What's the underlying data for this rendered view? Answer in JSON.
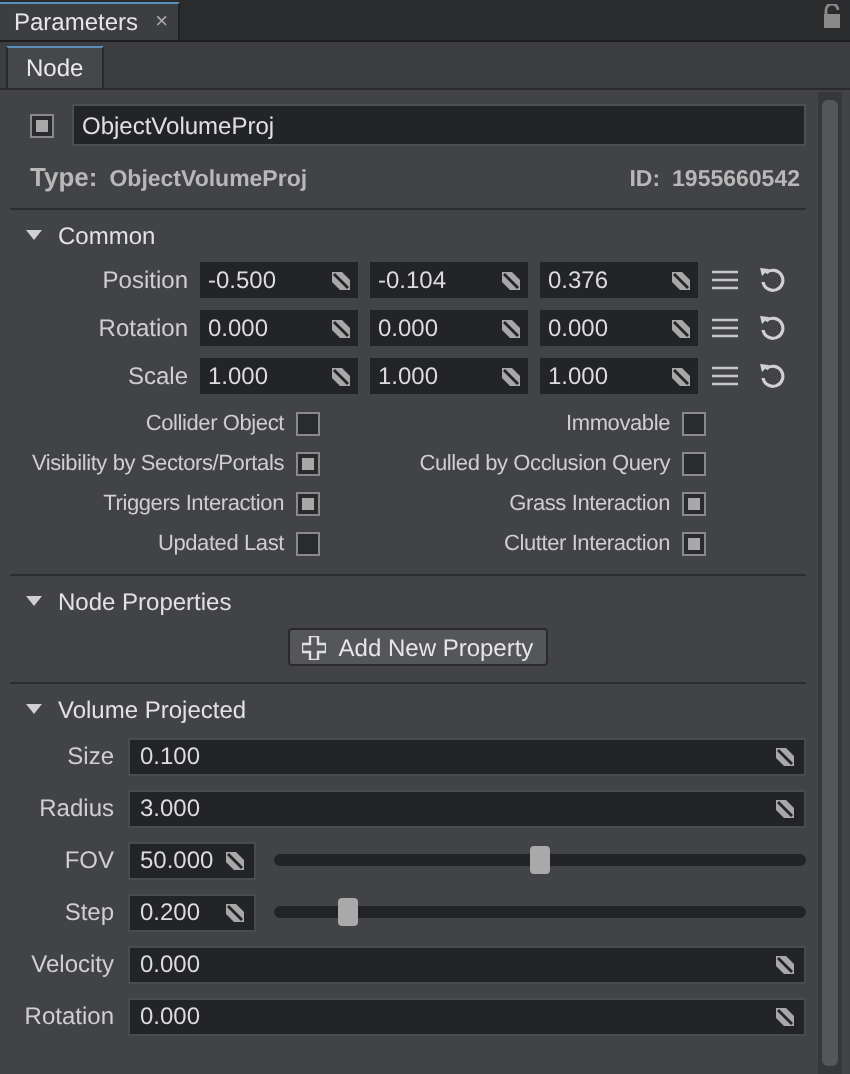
{
  "panel_tab": {
    "title": "Parameters",
    "close": "×"
  },
  "tabs": [
    {
      "label": "Node",
      "selected": true
    }
  ],
  "node": {
    "enabled": true,
    "name": "ObjectVolumeProj",
    "type_label": "Type:",
    "type_value": "ObjectVolumeProj",
    "id_label": "ID:",
    "id_value": "1955660542"
  },
  "common": {
    "title": "Common",
    "expanded": true,
    "vectors": [
      {
        "label": "Position",
        "values": [
          "-0.500",
          "-0.104",
          "0.376"
        ]
      },
      {
        "label": "Rotation",
        "values": [
          "0.000",
          "0.000",
          "0.000"
        ]
      },
      {
        "label": "Scale",
        "values": [
          "1.000",
          "1.000",
          "1.000"
        ]
      }
    ],
    "flags": [
      {
        "label": "Collider Object",
        "checked": false
      },
      {
        "label": "Immovable",
        "checked": false
      },
      {
        "label": "Visibility by Sectors/Portals",
        "checked": true
      },
      {
        "label": "Culled by Occlusion Query",
        "checked": false
      },
      {
        "label": "Triggers Interaction",
        "checked": true
      },
      {
        "label": "Grass Interaction",
        "checked": true
      },
      {
        "label": "Updated Last",
        "checked": false
      },
      {
        "label": "Clutter Interaction",
        "checked": true
      }
    ]
  },
  "node_properties": {
    "title": "Node Properties",
    "expanded": true,
    "button": "Add New Property"
  },
  "volume_projected": {
    "title": "Volume Projected",
    "expanded": true,
    "params": [
      {
        "kind": "field",
        "label": "Size",
        "value": "0.100"
      },
      {
        "kind": "field",
        "label": "Radius",
        "value": "3.000"
      },
      {
        "kind": "slider",
        "label": "FOV",
        "value": "50.000",
        "level": 0.5
      },
      {
        "kind": "slider",
        "label": "Step",
        "value": "0.200",
        "level": 0.125
      },
      {
        "kind": "field",
        "label": "Velocity",
        "value": "0.000"
      },
      {
        "kind": "field",
        "label": "Rotation",
        "value": "0.000"
      }
    ]
  }
}
